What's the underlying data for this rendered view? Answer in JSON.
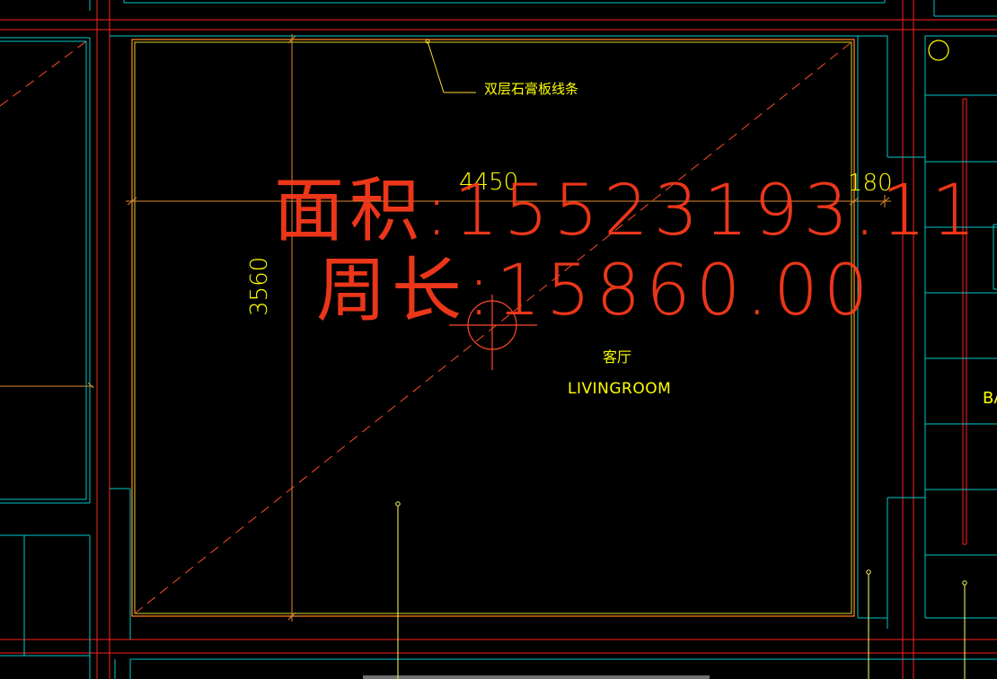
{
  "drawing": {
    "ceiling_note": "双层石膏板线条",
    "room_name_cn": "客厅",
    "room_name_en": "LIVINGROOM",
    "partial_label": "BA"
  },
  "dimensions": {
    "width": "4450",
    "height": "3560",
    "side": "180"
  },
  "measurement": {
    "area_text": "面积:15523193.11",
    "perimeter_text": "周长:15860.00"
  },
  "colors": {
    "background": "#000000",
    "red_line": "#ff2020",
    "cyan_line": "#00c8c8",
    "yellow": "#ffff00",
    "orange": "#ff7a1a",
    "dashed": "#ff4a2a"
  }
}
